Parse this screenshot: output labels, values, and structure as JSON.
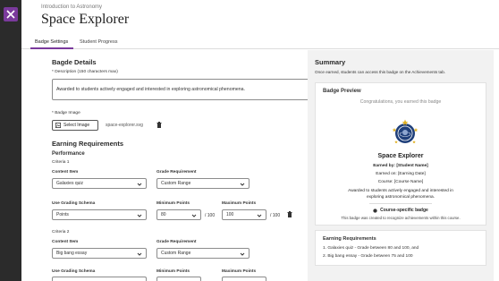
{
  "header": {
    "breadcrumb": "Introduction to Astronomy",
    "title": "Space Explorer"
  },
  "tabs": [
    {
      "label": "Badge Settings",
      "active": true
    },
    {
      "label": "Student Progress",
      "active": false
    }
  ],
  "badge_details": {
    "heading": "Bagde Details",
    "description_label": "* Description (150 characters max)",
    "description_value": "Awarded to students actively engaged and interested in exploring astronomical phenomena.",
    "image_label": "* Badge Image",
    "select_image_label": "Select Image",
    "image_file": "space-explorer.svg"
  },
  "earning": {
    "heading": "Earning Requirements",
    "subheading": "Performance",
    "criteria": [
      {
        "label": "Criteria 1",
        "content_item_label": "Content Item",
        "content_item_value": "Galaxies quiz",
        "grade_req_label": "Grade Requirement",
        "grade_req_value": "Custom Range",
        "schema_label": "Use Grading Schema",
        "schema_value": "Points",
        "min_label": "Minimum Points",
        "min_value": "80",
        "min_suffix": "/ 100",
        "max_label": "Maximum Points",
        "max_value": "100",
        "max_suffix": "/ 100"
      },
      {
        "label": "Criteria 2",
        "content_item_label": "Content Item",
        "content_item_value": "Big bang essay",
        "grade_req_label": "Grade Requirement",
        "grade_req_value": "Custom Range",
        "schema_label": "Use Grading Schema",
        "min_label": "Minimum Points",
        "max_label": "Maximum Points"
      }
    ]
  },
  "summary": {
    "heading": "Summary",
    "intro": "Once earned, students can access this badge on the Achievements tab.",
    "preview_heading": "Badge Preview",
    "congrats": "Congratulations, you earned this badge",
    "badge_title": "Space Explorer",
    "earned_by": "Earned by: [Student Name]",
    "earned_on": "Earned on: [Earning Date]",
    "course": "Course: [Course Name]",
    "award_text_1": "Awarded to students actively engaged and interested in",
    "award_text_2": "exploring astronomical phenomena.",
    "course_specific": "Course-specific badge",
    "course_specific_note": "This badge was created to recognize achievements within this course.",
    "requirements_heading": "Earning Requirements",
    "requirements": [
      "1. Galaxies quiz - Grade between 80 and 100, and",
      "2. Big bang essay - Grade between 75 and 100"
    ]
  },
  "colors": {
    "accent": "#7a3a9c",
    "badge_blue": "#1f3f7a",
    "star_gold": "#e0b020"
  }
}
